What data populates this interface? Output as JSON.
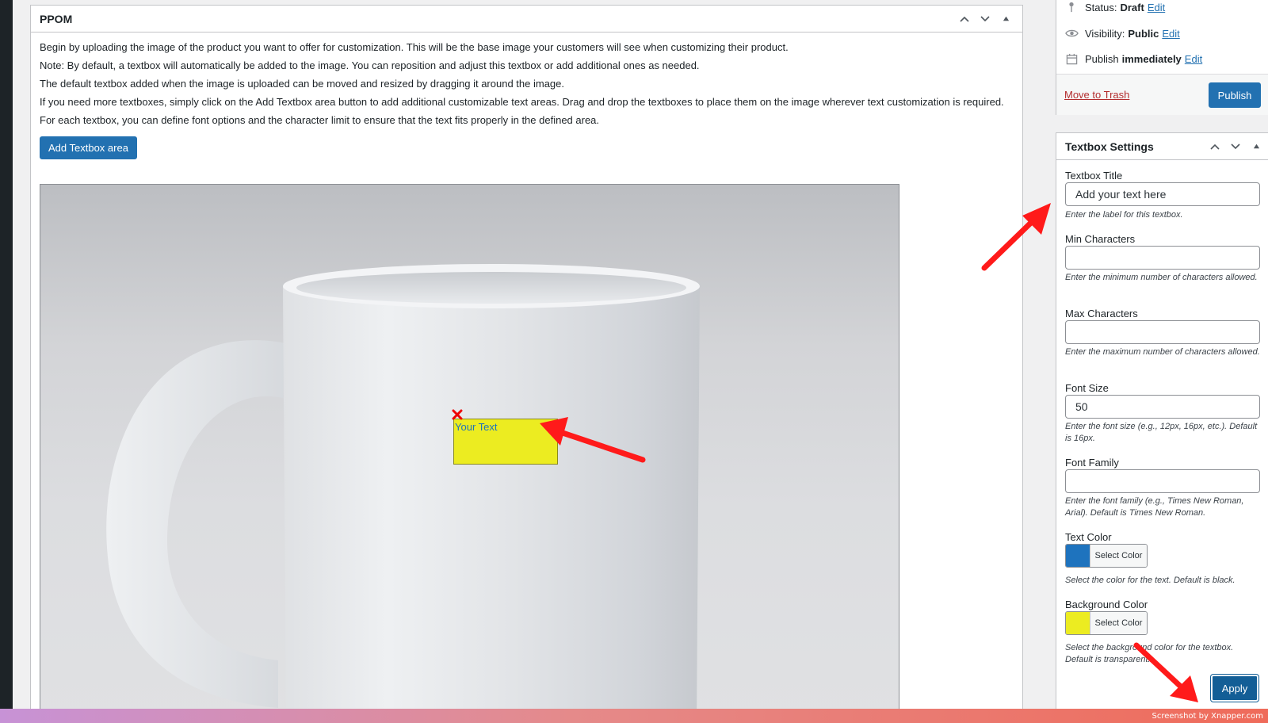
{
  "ppom": {
    "title": "PPOM",
    "intro": [
      "Begin by uploading the image of the product you want to offer for customization. This will be the base image your customers will see when customizing their product.",
      "Note: By default, a textbox will automatically be added to the image. You can reposition and adjust this textbox or add additional ones as needed.",
      "The default textbox added when the image is uploaded can be moved and resized by dragging it around the image.",
      "If you need more textboxes, simply click on the Add Textbox area button to add additional customizable text areas. Drag and drop the textboxes to place them on the image wherever text customization is required.",
      "For each textbox, you can define font options and the character limit to ensure that the text fits properly in the defined area."
    ],
    "add_textbox_label": "Add Textbox area",
    "textbox_text": "Your Text",
    "textbox_bg": "#ecec21",
    "textbox_text_color": "#1e73be"
  },
  "publish": {
    "status_label": "Status:",
    "status_value": "Draft",
    "visibility_label": "Visibility:",
    "visibility_value": "Public",
    "publish_label": "Publish",
    "publish_value": "immediately",
    "edit_label": "Edit",
    "trash_label": "Move to Trash",
    "publish_button": "Publish"
  },
  "settings": {
    "title": "Textbox Settings",
    "fields": {
      "title": {
        "label": "Textbox Title",
        "value": "Add your text here",
        "desc": "Enter the label for this textbox."
      },
      "min_chars": {
        "label": "Min Characters",
        "value": "",
        "desc": "Enter the minimum number of characters allowed."
      },
      "max_chars": {
        "label": "Max Characters",
        "value": "",
        "desc": "Enter the maximum number of characters allowed."
      },
      "font_size": {
        "label": "Font Size",
        "value": "50",
        "desc": "Enter the font size (e.g., 12px, 16px, etc.). Default is 16px."
      },
      "font_family": {
        "label": "Font Family",
        "value": "",
        "desc": "Enter the font family (e.g., Times New Roman, Arial). Default is Times New Roman."
      }
    },
    "text_color": {
      "label": "Text Color",
      "button": "Select Color",
      "swatch": "#1e73be",
      "desc": "Select the color for the text. Default is black."
    },
    "bg_color": {
      "label": "Background Color",
      "button": "Select Color",
      "swatch": "#ecec21",
      "desc": "Select the background color for the textbox. Default is transparent."
    },
    "apply_label": "Apply"
  },
  "footer": {
    "watermark": "Screenshot by Xnapper.com"
  },
  "colors": {
    "primary": "#2271b1",
    "annotation_arrow": "#ff1a1a"
  },
  "icons": [
    "pin-icon",
    "eye-icon",
    "calendar-icon",
    "chevron-up-icon",
    "chevron-down-icon",
    "triangle-up-icon",
    "close-icon"
  ]
}
